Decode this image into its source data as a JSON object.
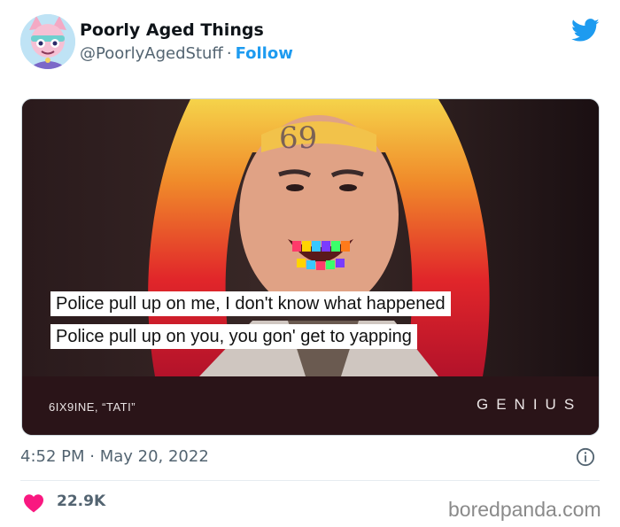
{
  "author": {
    "display_name": "Poorly Aged Things",
    "handle": "@PoorlyAgedStuff",
    "separator": "·",
    "follow_label": "Follow"
  },
  "media": {
    "lyrics": [
      "Police pull up on me, I don't know what happened",
      "Police pull up on you, you gon' get to yapping"
    ],
    "song_credit": "6IX9INE, “TATI”",
    "brand": "GENIUS"
  },
  "meta": {
    "timestamp": "4:52 PM · May 20, 2022"
  },
  "actions": {
    "like_count": "22.9K"
  },
  "watermark": "boredpanda.com",
  "colors": {
    "link_blue": "#1d9bf0",
    "like_red": "#f91880",
    "secondary_text": "#536471"
  },
  "icons": [
    "twitter-logo-icon",
    "info-icon",
    "heart-icon",
    "avatar-illustration"
  ]
}
